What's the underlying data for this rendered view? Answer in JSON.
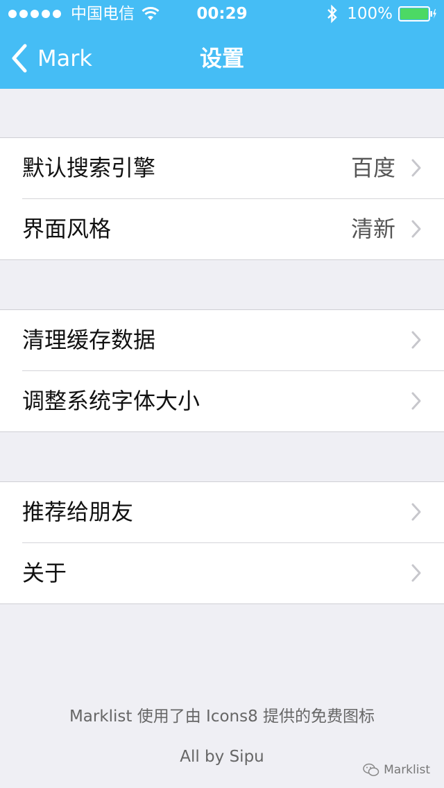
{
  "status_bar": {
    "carrier": "中国电信",
    "time": "00:29",
    "battery_percent": "100%",
    "battery_level": 1.0,
    "icons": [
      "signal-dots-icon",
      "wifi-icon",
      "bluetooth-icon",
      "battery-icon"
    ]
  },
  "nav": {
    "back_label": "Mark",
    "title": "设置"
  },
  "groups": [
    {
      "items": [
        {
          "label": "默认搜索引擎",
          "value": "百度"
        },
        {
          "label": "界面风格",
          "value": "清新"
        }
      ]
    },
    {
      "items": [
        {
          "label": "清理缓存数据",
          "value": ""
        },
        {
          "label": "调整系统字体大小",
          "value": ""
        }
      ]
    },
    {
      "items": [
        {
          "label": "推荐给朋友",
          "value": ""
        },
        {
          "label": "关于",
          "value": ""
        }
      ]
    }
  ],
  "footer": {
    "credit": "Marklist 使用了由 Icons8 提供的免费图标",
    "author": "All by Sipu"
  },
  "watermark": {
    "label": "Marklist"
  },
  "colors": {
    "header": "#45bdf5",
    "background": "#efeff4",
    "battery_fill": "#4cd964"
  }
}
